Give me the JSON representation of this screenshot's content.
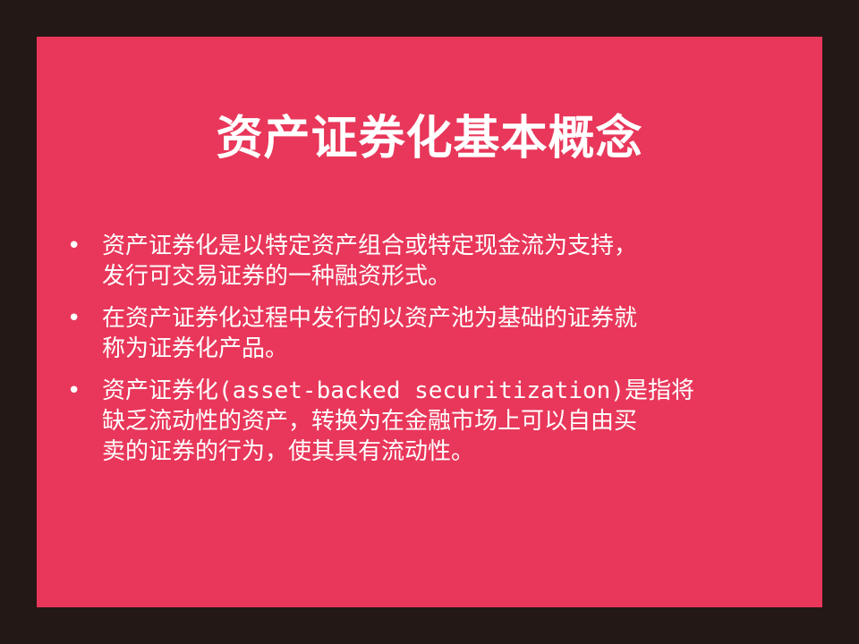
{
  "slide": {
    "title": "资产证券化基本概念",
    "bullet_symbol": "•",
    "bullets": [
      {
        "lines": [
          "资产证券化是以特定资产组合或特定现金流为支持，",
          "发行可交易证券的一种融资形式。"
        ]
      },
      {
        "lines": [
          "在资产证券化过程中发行的以资产池为基础的证券就",
          "称为证券化产品。"
        ]
      },
      {
        "lines": [
          "资产证券化(asset-backed securitization)是指将",
          "缺乏流动性的资产，转换为在金融市场上可以自由买",
          "卖的证券的行为，使其具有流动性。"
        ]
      }
    ]
  },
  "colors": {
    "frame": "#231815",
    "slide_background": "#e8375a",
    "text": "#ffffff"
  }
}
